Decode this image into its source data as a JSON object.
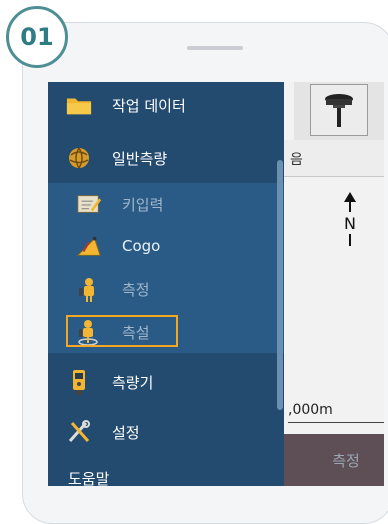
{
  "step": {
    "number": "01"
  },
  "map": {
    "toolbar_row_text": "음",
    "north_label": "N",
    "scale_label": ",000m",
    "measure_button_label": "측정"
  },
  "menu": {
    "items": [
      {
        "label": "작업 데이터",
        "icon": "folder-icon"
      },
      {
        "label": "일반측량",
        "icon": "globe-icon"
      }
    ],
    "submenu": [
      {
        "label": "키입력",
        "icon": "keyin-icon"
      },
      {
        "label": "Cogo",
        "icon": "cogo-icon"
      },
      {
        "label": "측정",
        "icon": "measure-icon"
      },
      {
        "label": "측설",
        "icon": "stakeout-icon",
        "selected": true
      }
    ],
    "bottom_items": [
      {
        "label": "측량기",
        "icon": "instrument-icon"
      },
      {
        "label": "설정",
        "icon": "settings-icon"
      },
      {
        "label": "도움말",
        "icon": "help-icon"
      }
    ]
  },
  "colors": {
    "drawer": "#234a6f",
    "submenu": "#2a5b86",
    "highlight": "#f5a623",
    "badge": "#4d8f95"
  }
}
